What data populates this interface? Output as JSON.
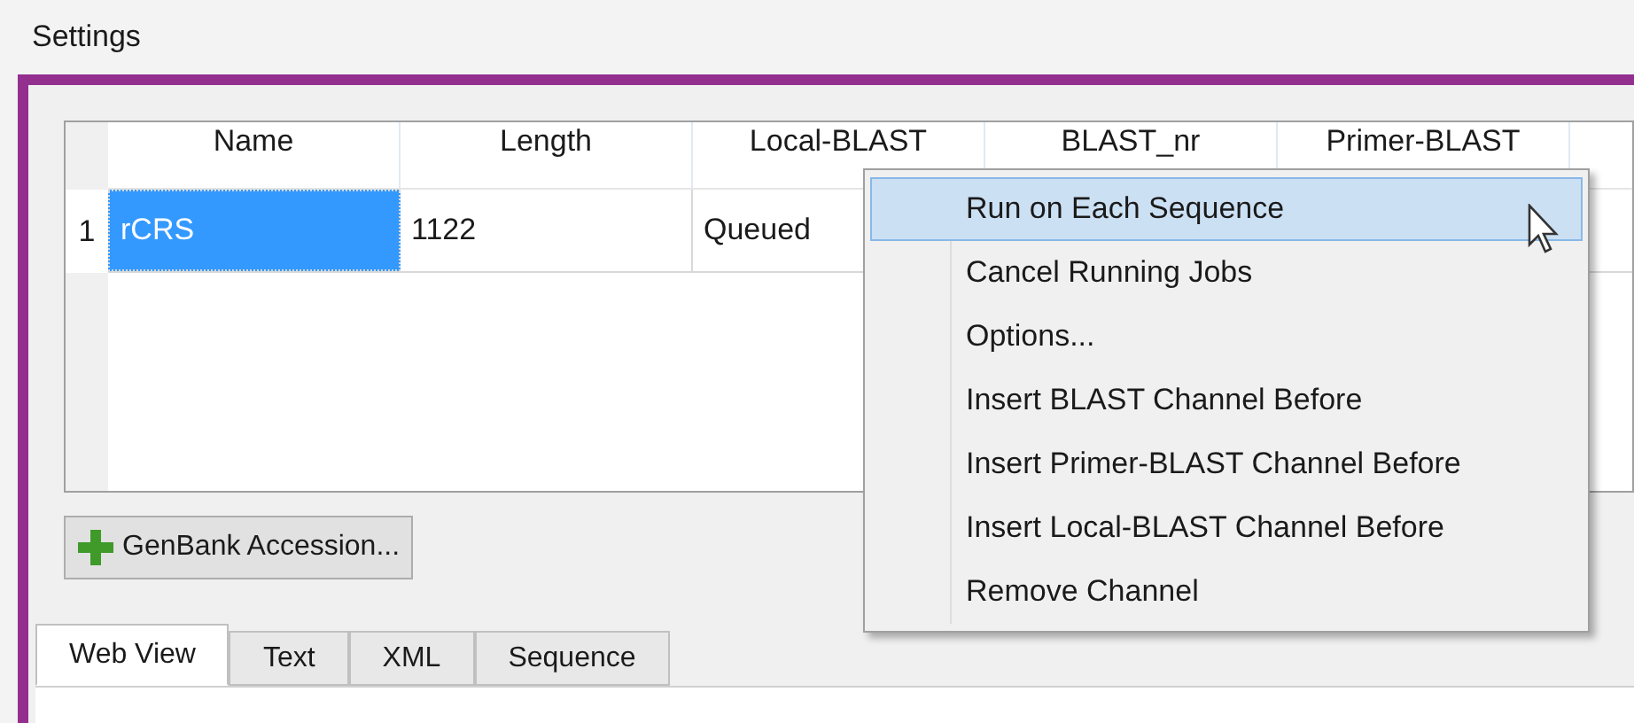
{
  "window": {
    "title": "Settings"
  },
  "table": {
    "columns": [
      "Name",
      "Length",
      "Local-BLAST",
      "BLAST_nr",
      "Primer-BLAST"
    ],
    "rows": [
      {
        "number": "1",
        "cells": [
          "rCRS",
          "1122",
          "Queued"
        ],
        "selected": true
      }
    ]
  },
  "add_button": {
    "label": "GenBank Accession..."
  },
  "tabs": [
    {
      "label": "Web View",
      "selected": true
    },
    {
      "label": "Text",
      "selected": false
    },
    {
      "label": "XML",
      "selected": false
    },
    {
      "label": "Sequence",
      "selected": false
    }
  ],
  "context_menu": {
    "items": [
      {
        "label": "Run on Each Sequence",
        "selected": true
      },
      {
        "label": "Cancel Running Jobs",
        "selected": false
      },
      {
        "label": "Options...",
        "selected": false
      },
      {
        "label": "Insert BLAST Channel Before",
        "selected": false
      },
      {
        "label": "Insert Primer-BLAST Channel Before",
        "selected": false
      },
      {
        "label": "Insert Local-BLAST Channel Before",
        "selected": false
      },
      {
        "label": "Remove Channel",
        "selected": false
      }
    ]
  }
}
